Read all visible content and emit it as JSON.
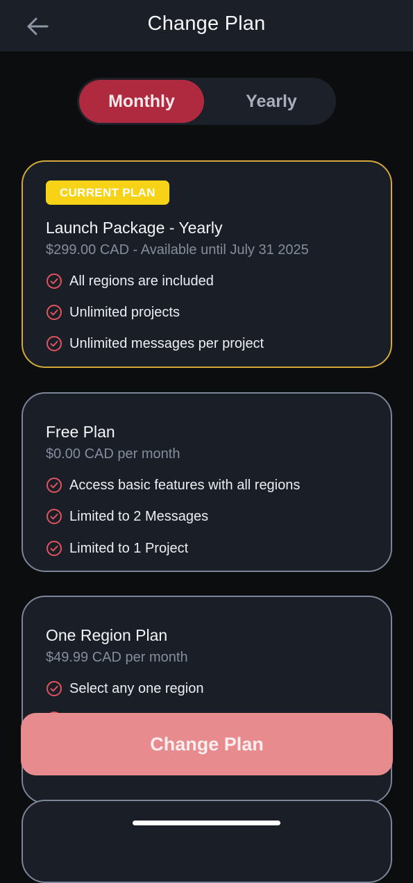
{
  "header": {
    "title": "Change Plan",
    "back_icon": "arrow-left-icon"
  },
  "billing_toggle": {
    "monthly_label": "Monthly",
    "yearly_label": "Yearly",
    "selected": "Monthly"
  },
  "plans": [
    {
      "badge": "CURRENT PLAN",
      "name": "Launch Package - Yearly",
      "price": "$299.00 CAD - Available until July 31 2025",
      "features": [
        "All regions are included",
        "Unlimited projects",
        "Unlimited messages per project"
      ]
    },
    {
      "name": "Free Plan",
      "price": "$0.00 CAD per month",
      "features": [
        "Access basic features with all regions",
        "Limited to 2 Messages",
        "Limited to 1 Project"
      ]
    },
    {
      "name": "One Region Plan",
      "price": "$49.99 CAD per month",
      "features": [
        "Select any one region"
      ]
    }
  ],
  "cta": {
    "label": "Change Plan"
  },
  "colors": {
    "accent": "#b02a3f",
    "cta": "#e78b8e",
    "current_border": "#d6a93d",
    "badge": "#f6d316",
    "card_bg": "#1a1e27",
    "check": "#e2545f"
  }
}
